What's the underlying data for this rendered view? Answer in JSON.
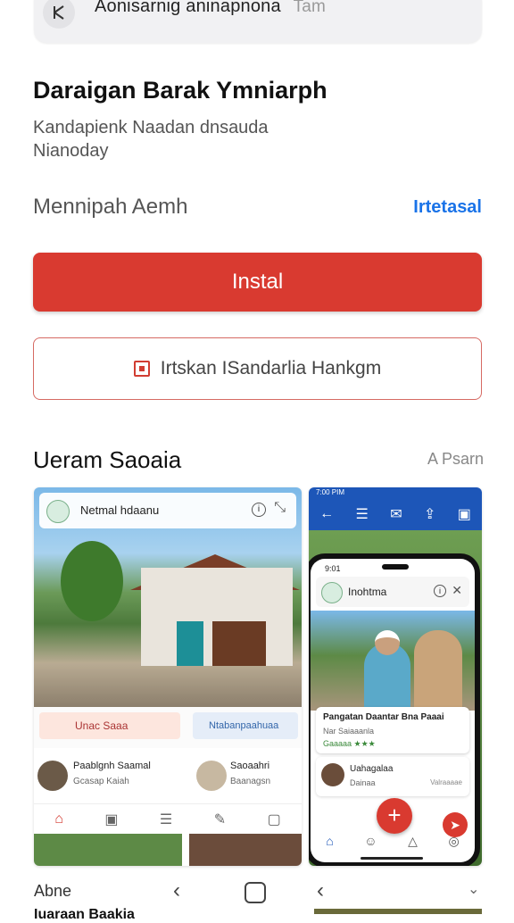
{
  "search": {
    "query": "Aonisarnig aninapnona",
    "suffix": "Tam"
  },
  "app": {
    "title": "Daraigan Barak Ymniarph",
    "developer": "Kandapienk Naadan dnsauda Nianoday"
  },
  "rating": {
    "label": "Mennipah Aemh",
    "link": "Irtetasal"
  },
  "buttons": {
    "install": "Instal",
    "secondary": "Irtskan ISandarlia Hankgm"
  },
  "screenshots_section": {
    "title": "Ueram Saoaia",
    "link": "A Psarn"
  },
  "shot1": {
    "header_title": "Netmal hdaanu",
    "pill_left": "Unac Saaa",
    "pill_right": "Ntabanpaahuaa",
    "person1_name": "Paablgnh Saamal",
    "person1_sub": "Gcasap Kaiah",
    "person2_name": "Saoaahri",
    "person2_sub": "Baanagsn"
  },
  "shot2": {
    "status_time": "7:00 PIM",
    "phone_time": "9:01",
    "header_title": "Inohtma",
    "card_title": "Pangatan Daantar Bna Paaai",
    "card_sub": "Nar Saiaaanla",
    "card_meta": "Gaaaaa ★★★",
    "list_name": "Uahagalaa",
    "list_sub": "Dainaa",
    "list_right": "Valraaaae"
  },
  "sysnav": {
    "label": "Abne"
  },
  "footer": {
    "peek": "Iuaraan Baakia"
  }
}
